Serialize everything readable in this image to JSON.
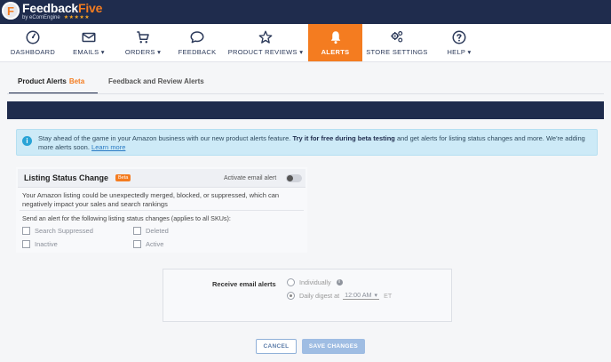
{
  "brand": {
    "logo_letter": "F",
    "title_main": "Feedback",
    "title_accent": "Five",
    "subtitle": "by eComEngine",
    "stars": "★★★★★",
    "accent_color": "#f47c20",
    "navy_color": "#1f2c4d"
  },
  "nav": {
    "items": [
      {
        "label": "DASHBOARD",
        "icon": "gauge-icon"
      },
      {
        "label": "EMAILS ▾",
        "icon": "envelope-icon"
      },
      {
        "label": "ORDERS ▾",
        "icon": "cart-icon"
      },
      {
        "label": "FEEDBACK",
        "icon": "speech-bubble-icon"
      },
      {
        "label": "PRODUCT REVIEWS ▾",
        "icon": "star-icon"
      },
      {
        "label": "ALERTS",
        "icon": "bell-icon"
      },
      {
        "label": "STORE SETTINGS",
        "icon": "gears-icon"
      },
      {
        "label": "HELP ▾",
        "icon": "question-icon"
      }
    ],
    "active": "ALERTS"
  },
  "tabs": {
    "product_alerts": "Product Alerts",
    "beta": "Beta",
    "feedback_review": "Feedback and Review Alerts"
  },
  "banner": {
    "text_1": "Stay ahead of the game in your Amazon business with our new product alerts feature.",
    "bold": "Try it for free during beta testing",
    "text_2": "and get alerts for listing status changes and more. We're adding more alerts soon.",
    "link": "Learn more"
  },
  "card": {
    "title": "Listing Status Change",
    "badge": "Beta",
    "activate_label": "Activate email alert",
    "description": "Your Amazon listing could be unexpectedly merged, blocked, or suppressed, which can negatively impact your sales and search rankings",
    "send_label": "Send an alert for the following listing status changes (applies to all SKUs):",
    "options": {
      "search_suppressed": "Search Suppressed",
      "deleted": "Deleted",
      "inactive": "Inactive",
      "active": "Active"
    }
  },
  "email": {
    "label": "Receive email alerts",
    "individually": "Individually",
    "daily_digest": "Daily digest at",
    "time": "12:00 AM",
    "timezone": "ET"
  },
  "buttons": {
    "cancel": "CANCEL",
    "save": "SAVE CHANGES"
  }
}
